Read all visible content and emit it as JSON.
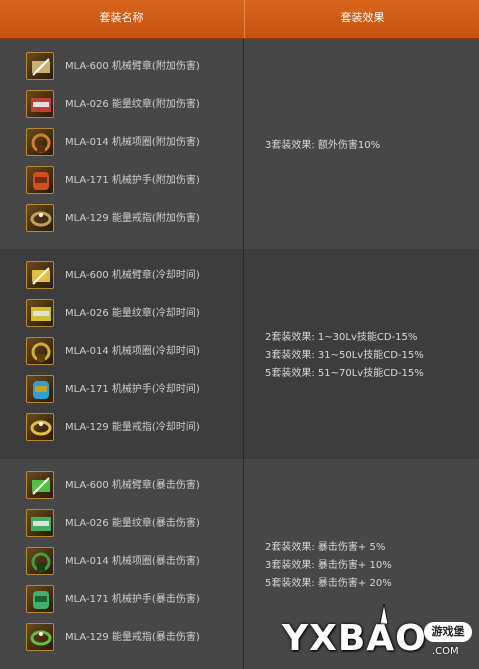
{
  "header": {
    "col_name": "套装名称",
    "col_effect": "套装效果"
  },
  "groups": [
    {
      "items": [
        {
          "label": "MLA-600 机械臂章(附加伤害)",
          "icon": "armband-icon",
          "accent": "#c8b070"
        },
        {
          "label": "MLA-026 能量纹章(附加伤害)",
          "icon": "emblem-icon",
          "accent": "#c04030"
        },
        {
          "label": "MLA-014 机械项圈(附加伤害)",
          "icon": "necklace-icon",
          "accent": "#d08030"
        },
        {
          "label": "MLA-171 机械护手(附加伤害)",
          "icon": "gauntlet-icon",
          "accent": "#d05020"
        },
        {
          "label": "MLA-129 能量戒指(附加伤害)",
          "icon": "ring-icon",
          "accent": "#c0a060"
        }
      ],
      "effects": [
        "3套装效果: 额外伤害10%"
      ]
    },
    {
      "items": [
        {
          "label": "MLA-600 机械臂章(冷却时间)",
          "icon": "armband-icon",
          "accent": "#e0c040"
        },
        {
          "label": "MLA-026 能量纹章(冷却时间)",
          "icon": "emblem-icon",
          "accent": "#d0c030"
        },
        {
          "label": "MLA-014 机械项圈(冷却时间)",
          "icon": "necklace-icon",
          "accent": "#d0b030"
        },
        {
          "label": "MLA-171 机械护手(冷却时间)",
          "icon": "gauntlet-icon",
          "accent": "#30a0d0"
        },
        {
          "label": "MLA-129 能量戒指(冷却时间)",
          "icon": "ring-icon",
          "accent": "#e0c040"
        }
      ],
      "effects": [
        "2套装效果: 1~30Lv技能CD-15%",
        "3套装效果: 31~50Lv技能CD-15%",
        "5套装效果: 51~70Lv技能CD-15%"
      ]
    },
    {
      "items": [
        {
          "label": "MLA-600 机械臂章(暴击伤害)",
          "icon": "armband-icon",
          "accent": "#50c040"
        },
        {
          "label": "MLA-026 能量纹章(暴击伤害)",
          "icon": "emblem-icon",
          "accent": "#40b060"
        },
        {
          "label": "MLA-014 机械项圈(暴击伤害)",
          "icon": "necklace-icon",
          "accent": "#40a040"
        },
        {
          "label": "MLA-171 机械护手(暴击伤害)",
          "icon": "gauntlet-icon",
          "accent": "#40b070"
        },
        {
          "label": "MLA-129 能量戒指(暴击伤害)",
          "icon": "ring-icon",
          "accent": "#60c040"
        }
      ],
      "effects": [
        "2套装效果: 暴击伤害+ 5%",
        "3套装效果: 暴击伤害+ 10%",
        "5套装效果: 暴击伤害+ 20%"
      ]
    }
  ],
  "watermark": {
    "brand": "YXBAO",
    "badge": "游戏堡",
    "suffix": ".COM"
  }
}
